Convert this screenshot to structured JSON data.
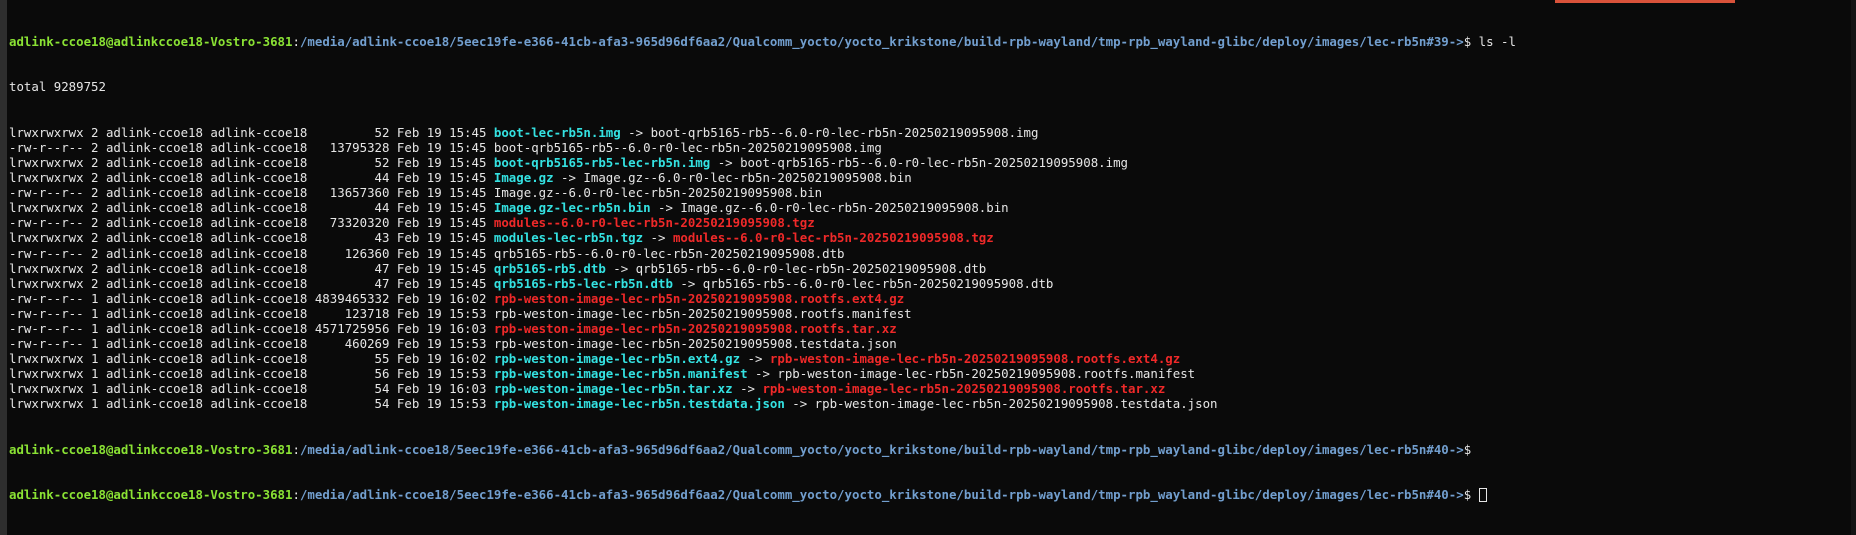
{
  "prompt": {
    "user_host": "adlink-ccoe18@adlinkccoe18-Vostro-3681",
    "path": "/media/adlink-ccoe18/5eec19fe-e366-41cb-afa3-965d96df6aa2/Qualcomm_yocto/yocto_krikstone/build-rpb-wayland/tmp-rpb_wayland-glibc/deploy/images/lec-rb5n",
    "sep": ":",
    "suffix1": "$ ls -l",
    "hist1": "#39->",
    "hist2": "#40->",
    "dollar": "$"
  },
  "total_line": "total 9289752",
  "listing": [
    {
      "meta": "lrwxrwxrwx 2 adlink-ccoe18 adlink-ccoe18         52 Feb 19 15:45 ",
      "name": "boot-lec-rb5n.img",
      "kind": "link",
      "arrow": " -> ",
      "target": "boot-qrb5165-rb5--6.0-r0-lec-rb5n-20250219095908.img",
      "target_kind": "plain"
    },
    {
      "meta": "-rw-r--r-- 2 adlink-ccoe18 adlink-ccoe18   13795328 Feb 19 15:45 ",
      "name": "boot-qrb5165-rb5--6.0-r0-lec-rb5n-20250219095908.img",
      "kind": "plain",
      "arrow": "",
      "target": "",
      "target_kind": "plain"
    },
    {
      "meta": "lrwxrwxrwx 2 adlink-ccoe18 adlink-ccoe18         52 Feb 19 15:45 ",
      "name": "boot-qrb5165-rb5-lec-rb5n.img",
      "kind": "link",
      "arrow": " -> ",
      "target": "boot-qrb5165-rb5--6.0-r0-lec-rb5n-20250219095908.img",
      "target_kind": "plain"
    },
    {
      "meta": "lrwxrwxrwx 2 adlink-ccoe18 adlink-ccoe18         44 Feb 19 15:45 ",
      "name": "Image.gz",
      "kind": "link",
      "arrow": " -> ",
      "target": "Image.gz--6.0-r0-lec-rb5n-20250219095908.bin",
      "target_kind": "plain"
    },
    {
      "meta": "-rw-r--r-- 2 adlink-ccoe18 adlink-ccoe18   13657360 Feb 19 15:45 ",
      "name": "Image.gz--6.0-r0-lec-rb5n-20250219095908.bin",
      "kind": "plain",
      "arrow": "",
      "target": "",
      "target_kind": "plain"
    },
    {
      "meta": "lrwxrwxrwx 2 adlink-ccoe18 adlink-ccoe18         44 Feb 19 15:45 ",
      "name": "Image.gz-lec-rb5n.bin",
      "kind": "link",
      "arrow": " -> ",
      "target": "Image.gz--6.0-r0-lec-rb5n-20250219095908.bin",
      "target_kind": "plain"
    },
    {
      "meta": "-rw-r--r-- 2 adlink-ccoe18 adlink-ccoe18   73320320 Feb 19 15:45 ",
      "name": "modules--6.0-r0-lec-rb5n-20250219095908.tgz",
      "kind": "archive",
      "arrow": "",
      "target": "",
      "target_kind": "plain"
    },
    {
      "meta": "lrwxrwxrwx 2 adlink-ccoe18 adlink-ccoe18         43 Feb 19 15:45 ",
      "name": "modules-lec-rb5n.tgz",
      "kind": "link",
      "arrow": " -> ",
      "target": "modules--6.0-r0-lec-rb5n-20250219095908.tgz",
      "target_kind": "archive"
    },
    {
      "meta": "-rw-r--r-- 2 adlink-ccoe18 adlink-ccoe18     126360 Feb 19 15:45 ",
      "name": "qrb5165-rb5--6.0-r0-lec-rb5n-20250219095908.dtb",
      "kind": "plain",
      "arrow": "",
      "target": "",
      "target_kind": "plain"
    },
    {
      "meta": "lrwxrwxrwx 2 adlink-ccoe18 adlink-ccoe18         47 Feb 19 15:45 ",
      "name": "qrb5165-rb5.dtb",
      "kind": "link",
      "arrow": " -> ",
      "target": "qrb5165-rb5--6.0-r0-lec-rb5n-20250219095908.dtb",
      "target_kind": "plain"
    },
    {
      "meta": "lrwxrwxrwx 2 adlink-ccoe18 adlink-ccoe18         47 Feb 19 15:45 ",
      "name": "qrb5165-rb5-lec-rb5n.dtb",
      "kind": "link",
      "arrow": " -> ",
      "target": "qrb5165-rb5--6.0-r0-lec-rb5n-20250219095908.dtb",
      "target_kind": "plain"
    },
    {
      "meta": "-rw-r--r-- 1 adlink-ccoe18 adlink-ccoe18 4839465332 Feb 19 16:02 ",
      "name": "rpb-weston-image-lec-rb5n-20250219095908.rootfs.ext4.gz",
      "kind": "archive",
      "arrow": "",
      "target": "",
      "target_kind": "plain"
    },
    {
      "meta": "-rw-r--r-- 1 adlink-ccoe18 adlink-ccoe18     123718 Feb 19 15:53 ",
      "name": "rpb-weston-image-lec-rb5n-20250219095908.rootfs.manifest",
      "kind": "plain",
      "arrow": "",
      "target": "",
      "target_kind": "plain"
    },
    {
      "meta": "-rw-r--r-- 1 adlink-ccoe18 adlink-ccoe18 4571725956 Feb 19 16:03 ",
      "name": "rpb-weston-image-lec-rb5n-20250219095908.rootfs.tar.xz",
      "kind": "archive",
      "arrow": "",
      "target": "",
      "target_kind": "plain"
    },
    {
      "meta": "-rw-r--r-- 1 adlink-ccoe18 adlink-ccoe18     460269 Feb 19 15:53 ",
      "name": "rpb-weston-image-lec-rb5n-20250219095908.testdata.json",
      "kind": "plain",
      "arrow": "",
      "target": "",
      "target_kind": "plain"
    },
    {
      "meta": "lrwxrwxrwx 1 adlink-ccoe18 adlink-ccoe18         55 Feb 19 16:02 ",
      "name": "rpb-weston-image-lec-rb5n.ext4.gz",
      "kind": "link",
      "arrow": " -> ",
      "target": "rpb-weston-image-lec-rb5n-20250219095908.rootfs.ext4.gz",
      "target_kind": "archive"
    },
    {
      "meta": "lrwxrwxrwx 1 adlink-ccoe18 adlink-ccoe18         56 Feb 19 15:53 ",
      "name": "rpb-weston-image-lec-rb5n.manifest",
      "kind": "link",
      "arrow": " -> ",
      "target": "rpb-weston-image-lec-rb5n-20250219095908.rootfs.manifest",
      "target_kind": "plain"
    },
    {
      "meta": "lrwxrwxrwx 1 adlink-ccoe18 adlink-ccoe18         54 Feb 19 16:03 ",
      "name": "rpb-weston-image-lec-rb5n.tar.xz",
      "kind": "link",
      "arrow": " -> ",
      "target": "rpb-weston-image-lec-rb5n-20250219095908.rootfs.tar.xz",
      "target_kind": "archive"
    },
    {
      "meta": "lrwxrwxrwx 1 adlink-ccoe18 adlink-ccoe18         54 Feb 19 15:53 ",
      "name": "rpb-weston-image-lec-rb5n.testdata.json",
      "kind": "link",
      "arrow": " -> ",
      "target": "rpb-weston-image-lec-rb5n-20250219095908.testdata.json",
      "target_kind": "plain"
    }
  ],
  "colors": {
    "background": "#0a0a0a",
    "user_host": "#8ae234",
    "path": "#729fcf",
    "symlink": "#34e2e2",
    "archive": "#ef2929",
    "text": "#e6e6e6",
    "accent": "#d9523a"
  }
}
